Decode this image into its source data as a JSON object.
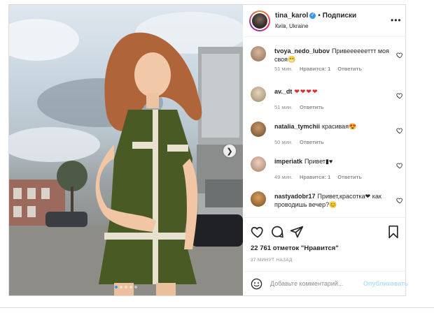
{
  "header": {
    "username": "tina_karol",
    "dot": "•",
    "follow_label": "Подписки",
    "location": "Київ, Ukraine",
    "more_label": "•••"
  },
  "photo": {
    "next_glyph": "❯",
    "slide_count": 5,
    "active_slide": 1
  },
  "comments": [
    {
      "user": "tvoya_nedo_lubov",
      "text": "Привееееееттт моя своя😁",
      "time": "51 мин.",
      "likes": "Нравится: 1",
      "reply": "Ответить"
    },
    {
      "user": "av._dt",
      "text": "❤❤❤❤",
      "time": "51 мин.",
      "likes": "",
      "reply": "Ответить"
    },
    {
      "user": "natalia_tymchii",
      "text": "красивая😍",
      "time": "50 мин.",
      "likes": "",
      "reply": "Ответить"
    },
    {
      "user": "imperiatk",
      "text": "Привет▮♥",
      "time": "49 мин.",
      "likes": "Нравится: 1",
      "reply": "Ответить"
    },
    {
      "user": "nastyadobr17",
      "text": "Привет,красотка❤ как проводишь вечер?😊",
      "time": "",
      "likes": "",
      "reply": ""
    }
  ],
  "post": {
    "likes_text": "22 761 отметок \"Нравится\"",
    "time_ago": "37 МИНУТ НАЗАД"
  },
  "add_comment": {
    "placeholder": "Добавьте комментарий...",
    "publish_label": "Опубликовать"
  },
  "colors": {
    "accent": "#3897f0",
    "publish_disabled": "#b2dffc",
    "heart_red": "#e02a2a"
  },
  "icons": [
    "heart-icon",
    "comment-icon",
    "share-icon",
    "bookmark-icon",
    "smile-icon",
    "more-icon",
    "chevron-right-icon",
    "verified-icon"
  ]
}
